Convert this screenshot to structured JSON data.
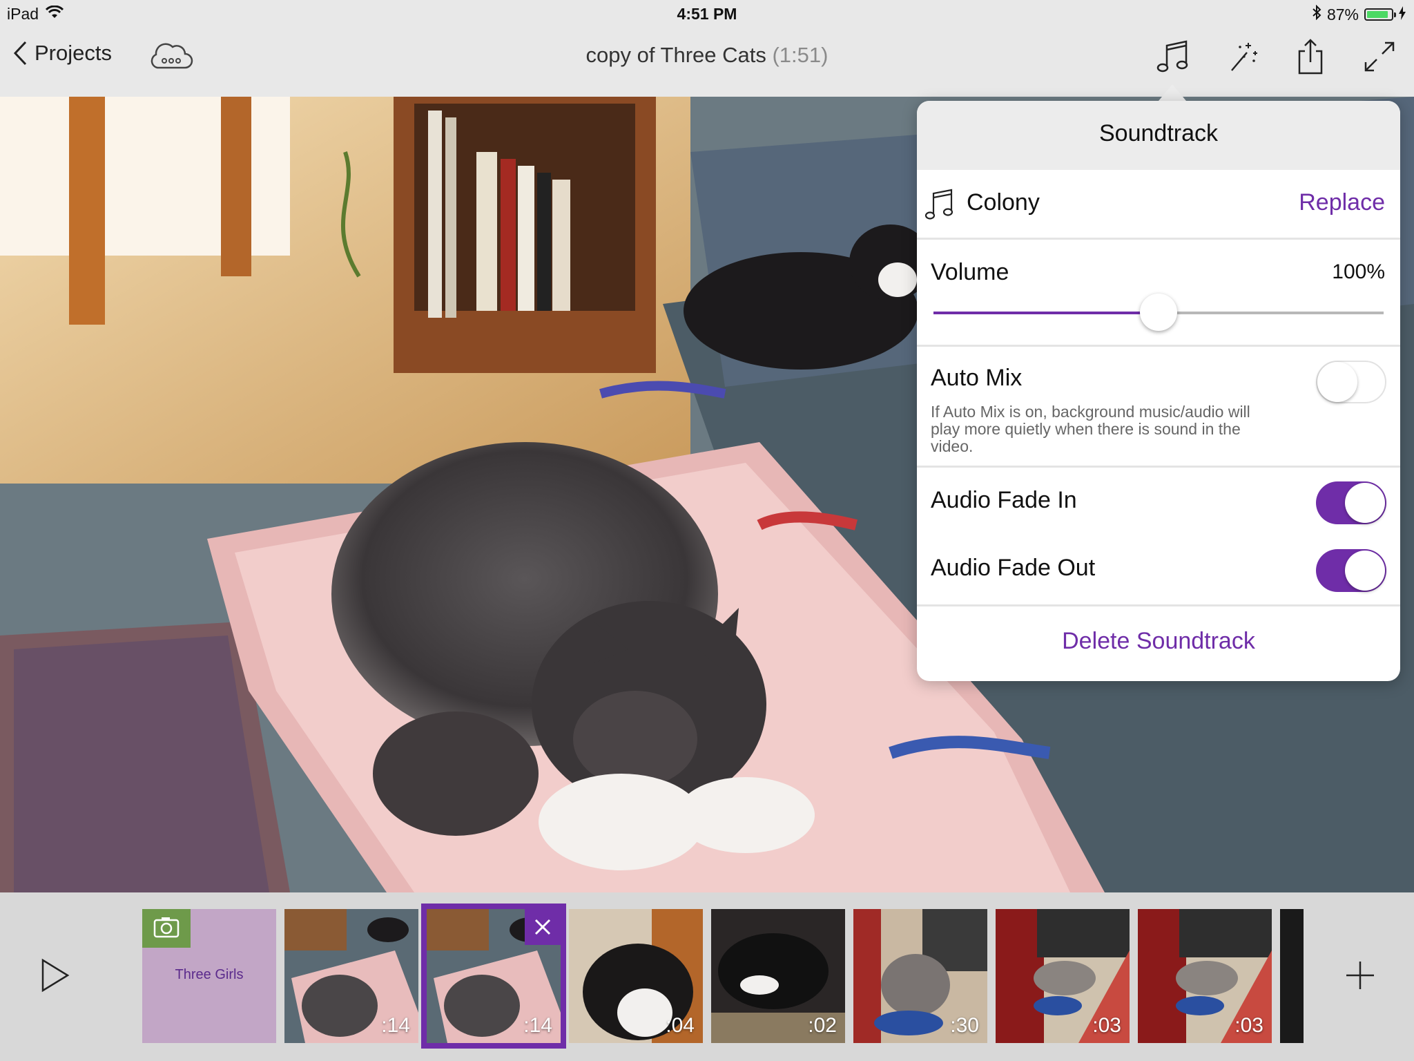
{
  "status_bar": {
    "device": "iPad",
    "time": "4:51 PM",
    "battery_percent": "87%",
    "battery_level": 0.87
  },
  "nav": {
    "back_label": "Projects",
    "title": "copy of Three Cats",
    "duration": "(1:51)",
    "icons": [
      "cloud-icon",
      "music-note-icon",
      "magic-wand-icon",
      "share-icon",
      "fullscreen-icon"
    ]
  },
  "soundtrack": {
    "title": "Soundtrack",
    "song": "Colony",
    "replace_label": "Replace",
    "volume_label": "Volume",
    "volume_value": "100%",
    "volume_level": 0.5,
    "automix_label": "Auto Mix",
    "automix_desc": "If Auto Mix is on, background music/audio will play more quietly when there is sound in the video.",
    "automix_on": false,
    "fade_in_label": "Audio Fade In",
    "fade_in_on": true,
    "fade_out_label": "Audio Fade Out",
    "fade_out_on": true,
    "delete_label": "Delete Soundtrack"
  },
  "timeline": {
    "title_card": "Three Girls",
    "clips": [
      {
        "duration": ":14",
        "selected": false
      },
      {
        "duration": ":14",
        "selected": true
      },
      {
        "duration": ":04",
        "selected": false
      },
      {
        "duration": ":02",
        "selected": false
      },
      {
        "duration": ":30",
        "selected": false
      },
      {
        "duration": ":03",
        "selected": false
      },
      {
        "duration": ":03",
        "selected": false
      }
    ]
  },
  "colors": {
    "accent": "#6f2da8",
    "bar_background": "#e8e8e8",
    "title_card": "#c2a6c6",
    "camera_badge": "#6e9a4a"
  }
}
